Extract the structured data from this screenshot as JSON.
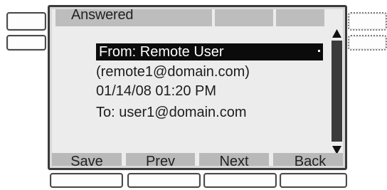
{
  "screen": {
    "title": "Answered",
    "message": {
      "from": "From: Remote User",
      "address": "(remote1@domain.com)",
      "datetime": "01/14/08 01:20 PM",
      "to": "To: user1@domain.com"
    },
    "softkeys": [
      {
        "label": "Save"
      },
      {
        "label": "Prev"
      },
      {
        "label": "Next"
      },
      {
        "label": "Back"
      }
    ]
  },
  "icons": {
    "scroll_up": "arrow-up-icon",
    "scroll_down": "arrow-down-icon"
  }
}
